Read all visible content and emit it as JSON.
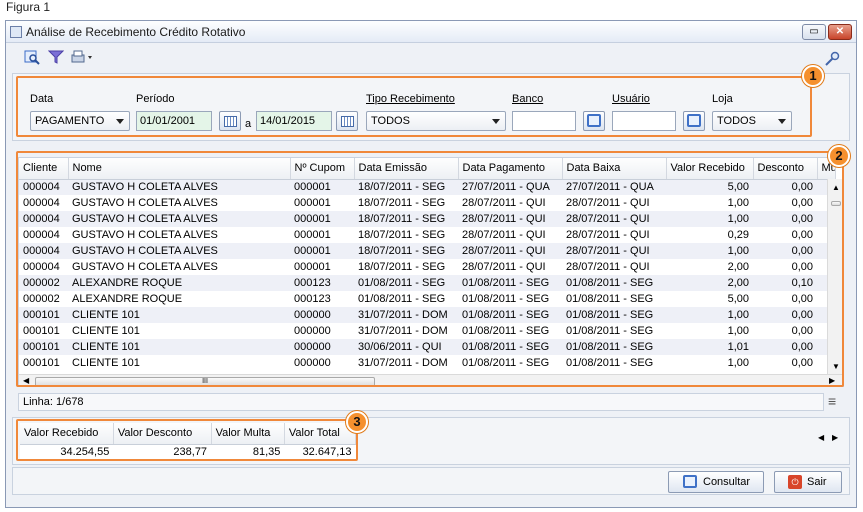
{
  "caption": "Figura 1",
  "window": {
    "title": "Análise de Recebimento Crédito Rotativo",
    "minimize": "▭",
    "close": "✕"
  },
  "toolbar": {
    "icons": [
      "report-search-icon",
      "filter-icon",
      "print-icon",
      "key-icon"
    ]
  },
  "filters": {
    "badge": "1",
    "data_label": "Data",
    "data_value": "PAGAMENTO",
    "periodo_label": "Período",
    "periodo_from": "01/01/2001",
    "periodo_sep": "a",
    "periodo_to": "14/01/2015",
    "tipo_label": "Tipo Recebimento",
    "tipo_value": "TODOS",
    "banco_label": "Banco",
    "banco_value": "",
    "usuario_label": "Usuário",
    "usuario_value": "",
    "loja_label": "Loja",
    "loja_value": "TODOS"
  },
  "grid": {
    "badge": "2",
    "columns": [
      "Cliente",
      "Nome",
      "Nº Cupom",
      "Data Emissão",
      "Data Pagamento",
      "Data Baixa",
      "Valor Recebido",
      "Desconto",
      "Mu"
    ],
    "rows": [
      [
        "000004",
        "GUSTAVO H COLETA ALVES",
        "000001",
        "18/07/2011 - SEG",
        "27/07/2011 - QUA",
        "27/07/2011 - QUA",
        "5,00",
        "0,00"
      ],
      [
        "000004",
        "GUSTAVO H COLETA ALVES",
        "000001",
        "18/07/2011 - SEG",
        "28/07/2011 - QUI",
        "28/07/2011 - QUI",
        "1,00",
        "0,00"
      ],
      [
        "000004",
        "GUSTAVO H COLETA ALVES",
        "000001",
        "18/07/2011 - SEG",
        "28/07/2011 - QUI",
        "28/07/2011 - QUI",
        "1,00",
        "0,00"
      ],
      [
        "000004",
        "GUSTAVO H COLETA ALVES",
        "000001",
        "18/07/2011 - SEG",
        "28/07/2011 - QUI",
        "28/07/2011 - QUI",
        "0,29",
        "0,00"
      ],
      [
        "000004",
        "GUSTAVO H COLETA ALVES",
        "000001",
        "18/07/2011 - SEG",
        "28/07/2011 - QUI",
        "28/07/2011 - QUI",
        "1,00",
        "0,00"
      ],
      [
        "000004",
        "GUSTAVO H COLETA ALVES",
        "000001",
        "18/07/2011 - SEG",
        "28/07/2011 - QUI",
        "28/07/2011 - QUI",
        "2,00",
        "0,00"
      ],
      [
        "000002",
        "ALEXANDRE ROQUE",
        "000123",
        "01/08/2011 - SEG",
        "01/08/2011 - SEG",
        "01/08/2011 - SEG",
        "2,00",
        "0,10"
      ],
      [
        "000002",
        "ALEXANDRE ROQUE",
        "000123",
        "01/08/2011 - SEG",
        "01/08/2011 - SEG",
        "01/08/2011 - SEG",
        "5,00",
        "0,00"
      ],
      [
        "000101",
        "CLIENTE 101",
        "000000",
        "31/07/2011 - DOM",
        "01/08/2011 - SEG",
        "01/08/2011 - SEG",
        "1,00",
        "0,00"
      ],
      [
        "000101",
        "CLIENTE 101",
        "000000",
        "31/07/2011 - DOM",
        "01/08/2011 - SEG",
        "01/08/2011 - SEG",
        "1,00",
        "0,00"
      ],
      [
        "000101",
        "CLIENTE 101",
        "000000",
        "30/06/2011 - QUI",
        "01/08/2011 - SEG",
        "01/08/2011 - SEG",
        "1,01",
        "0,00"
      ],
      [
        "000101",
        "CLIENTE 101",
        "000000",
        "31/07/2011 - DOM",
        "01/08/2011 - SEG",
        "01/08/2011 - SEG",
        "1,00",
        "0,00"
      ]
    ],
    "hscroll_grip": "III"
  },
  "status": {
    "linha": "Linha: 1/678",
    "menu_icon": "≡"
  },
  "totals": {
    "badge": "3",
    "columns": [
      "Valor Recebido",
      "Valor Desconto",
      "Valor Multa",
      "Valor Total"
    ],
    "values": [
      "34.254,55",
      "238,77",
      "81,35",
      "32.647,13"
    ]
  },
  "buttons": {
    "consultar": "Consultar",
    "sair": "Sair"
  }
}
